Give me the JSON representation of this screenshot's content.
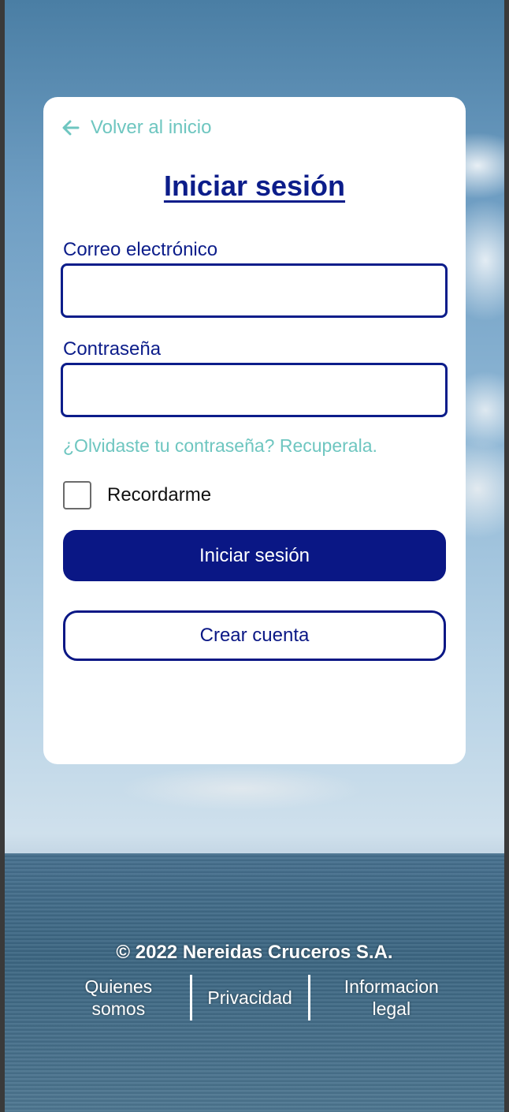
{
  "login": {
    "back_label": "Volver al inicio",
    "title": "Iniciar sesión",
    "email_label": "Correo electrónico",
    "email_value": "",
    "password_label": "Contraseña",
    "password_value": "",
    "forgot_link": "¿Olvidaste tu contraseña? Recuperala.",
    "remember_label": "Recordarme",
    "remember_checked": false,
    "submit_label": "Iniciar sesión",
    "create_account_label": "Crear cuenta"
  },
  "footer": {
    "copyright": "© 2022 Nereidas Cruceros S.A.",
    "links": [
      {
        "line1": "Quienes",
        "line2": "somos"
      },
      {
        "line1": "Privacidad",
        "line2": ""
      },
      {
        "line1": "Informacion",
        "line2": "legal"
      }
    ]
  },
  "colors": {
    "primary": "#0a1785",
    "accent": "#6ec6c0",
    "card": "#ffffff"
  },
  "icons": {
    "back": "arrow-left-icon"
  }
}
